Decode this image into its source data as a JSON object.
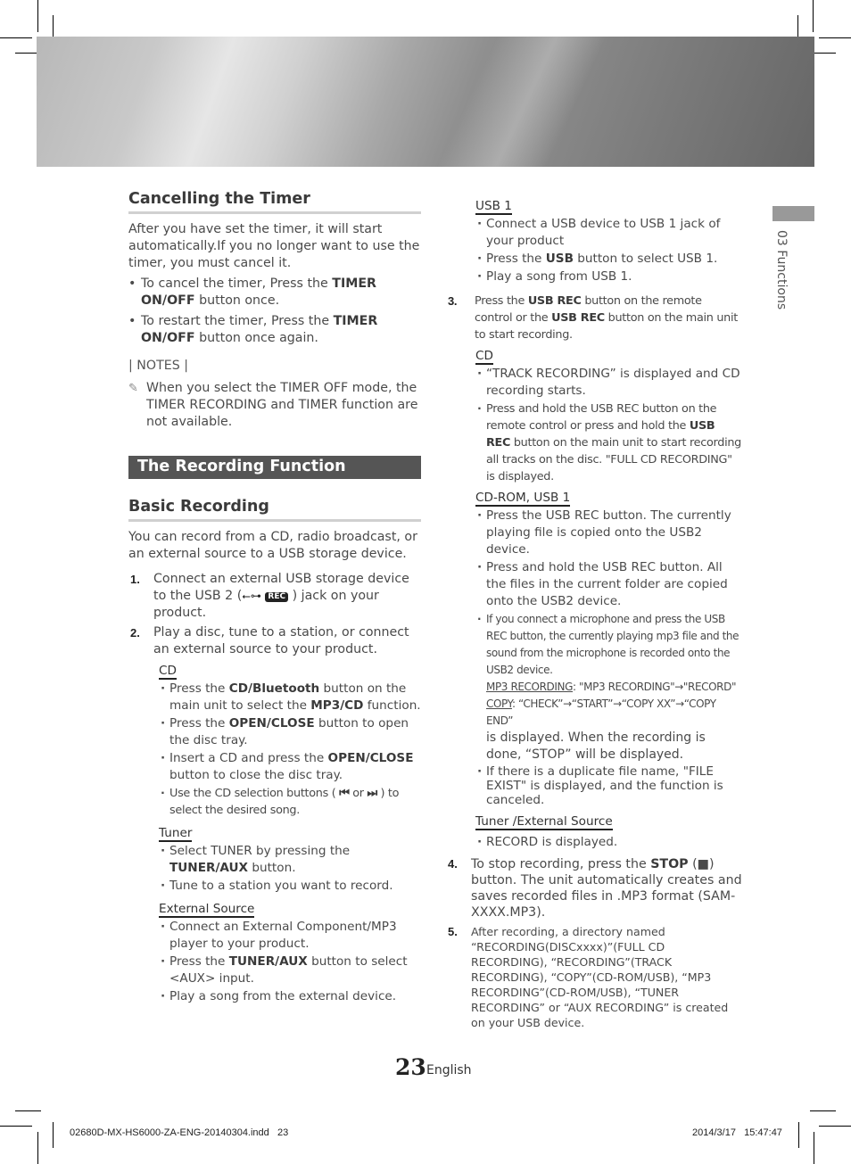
{
  "side_tab": {
    "label": "03   Functions"
  },
  "cancel_timer": {
    "title": "Cancelling the Timer",
    "intro": "After you have set the timer, it will start automatically.If you no longer want to use the timer, you must cancel it.",
    "bullets": [
      {
        "pre": "To cancel the timer, Press the ",
        "bold": "TIMER ON/OFF",
        "post": " button once."
      },
      {
        "pre": "To restart the timer, Press the ",
        "bold": "TIMER ON/OFF",
        "post": " button once again."
      }
    ],
    "notes_heading": "| NOTES |",
    "note_icon": "pencil-note-icon",
    "note": "When you select the TIMER OFF mode, the TIMER RECORDING and TIMER function are not available."
  },
  "recording_function": {
    "title": "The Recording Function"
  },
  "basic_recording": {
    "title": "Basic Recording",
    "intro": "You can record from a CD, radio broadcast, or an external source to a USB storage device.",
    "step1": {
      "num": "1.",
      "pre": "Connect an external USB storage device to the USB 2 (",
      "usb_glyph": "⭠",
      "rec_badge": "REC",
      "post": " ) jack on your product."
    },
    "step2": {
      "num": "2.",
      "text": "Play a disc, tune to a station, or connect an external source to your product."
    },
    "cd": {
      "heading": "CD",
      "items": [
        {
          "pre": "Press the ",
          "b1": "CD/Bluetooth",
          "mid": " button on the main unit to select the ",
          "b2": "MP3/CD",
          "post": " function."
        },
        {
          "pre": "Press the ",
          "b1": "OPEN/CLOSE",
          "post": " button to open the disc tray."
        },
        {
          "pre": "Insert a CD and press the ",
          "b1": "OPEN/CLOSE",
          "post": " button to close the disc tray."
        },
        {
          "pre": "Use the CD selection buttons ( ",
          "prev_icon": "⏮",
          "mid": " or ",
          "next_icon": "⏭",
          "post": " ) to select the desired song."
        }
      ]
    },
    "tuner": {
      "heading": "Tuner",
      "items": [
        {
          "pre": "Select TUNER by pressing the ",
          "b1": "TUNER/AUX",
          "post": " button."
        },
        {
          "text": "Tune to a station you want to record."
        }
      ]
    },
    "external": {
      "heading": "External Source",
      "items": [
        {
          "text": "Connect an External Component/MP3 player to your product."
        },
        {
          "pre": "Press the ",
          "b1": "TUNER/AUX",
          "post": " button to select <AUX> input."
        },
        {
          "text": "Play a song from the external device."
        }
      ]
    },
    "usb1": {
      "heading": "USB 1",
      "items": [
        {
          "text": "Connect a USB device to USB 1 jack of your product"
        },
        {
          "pre": "Press the ",
          "b1": "USB",
          "post": " button to select USB 1."
        },
        {
          "text": "Play a song from USB 1."
        }
      ]
    },
    "step3": {
      "num": "3.",
      "pre": "Press the ",
      "b1": "USB REC",
      "mid": " button on the remote control or the ",
      "b2": "USB REC",
      "post": " button on the main unit to start recording."
    },
    "cd_rec": {
      "heading": "CD",
      "item1": "“TRACK RECORDING” is displayed and CD recording starts.",
      "item2": {
        "pre": "Press and hold the USB REC button on the remote control or press and hold the ",
        "b1": "USB REC",
        "post": " button on the main unit to start recording all tracks on the disc. \"FULL CD RECORDING\" is displayed."
      }
    },
    "cdrom_rec": {
      "heading": "CD-ROM, USB 1",
      "item1": "Press the USB REC button. The currently playing file is copied onto the USB2 device.",
      "item2": "Press and hold the USB REC button. All the files in the current folder are copied onto the USB2 device.",
      "item3": "If you connect a microphone and press the USB REC button, the currently playing mp3 file and the sound from the microphone is recorded onto the USB2 device.",
      "mp3_label": "MP3 RECORDING",
      "mp3_seq": ": \"MP3 RECORDING\"→\"RECORD\"",
      "copy_label": "COPY",
      "copy_seq": ": “CHECK”→“START”→“COPY XX”→“COPY END”",
      "item3_tail": " is displayed. When the recording is done, “STOP” will be displayed.",
      "item4": "If there is a duplicate file name, \"FILE EXIST\" is  displayed, and the function is canceled."
    },
    "tuner_ext_rec": {
      "heading": "Tuner /External Source",
      "item1": "RECORD is displayed."
    },
    "step4": {
      "num": "4.",
      "pre": "To stop recording, press the ",
      "b1": "STOP",
      "mid": " (■)",
      "post": " button. The unit automatically creates and saves recorded files in .MP3 format (SAM-XXXX.MP3)."
    },
    "step5": {
      "num": "5.",
      "text": "After recording, a directory named “RECORDING(DISCxxxx)”(FULL CD RECORDING), “RECORDING”(TRACK RECORDING), “COPY”(CD-ROM/USB), “MP3 RECORDING”(CD-ROM/USB), “TUNER RECORDING” or “AUX RECORDING” is created on your USB device."
    }
  },
  "footer": {
    "page_number": "23",
    "language": "English",
    "slug_file": "02680D-MX-HS6000-ZA-ENG-20140304.indd   23",
    "slug_date": "2014/3/17   15:47:47"
  }
}
